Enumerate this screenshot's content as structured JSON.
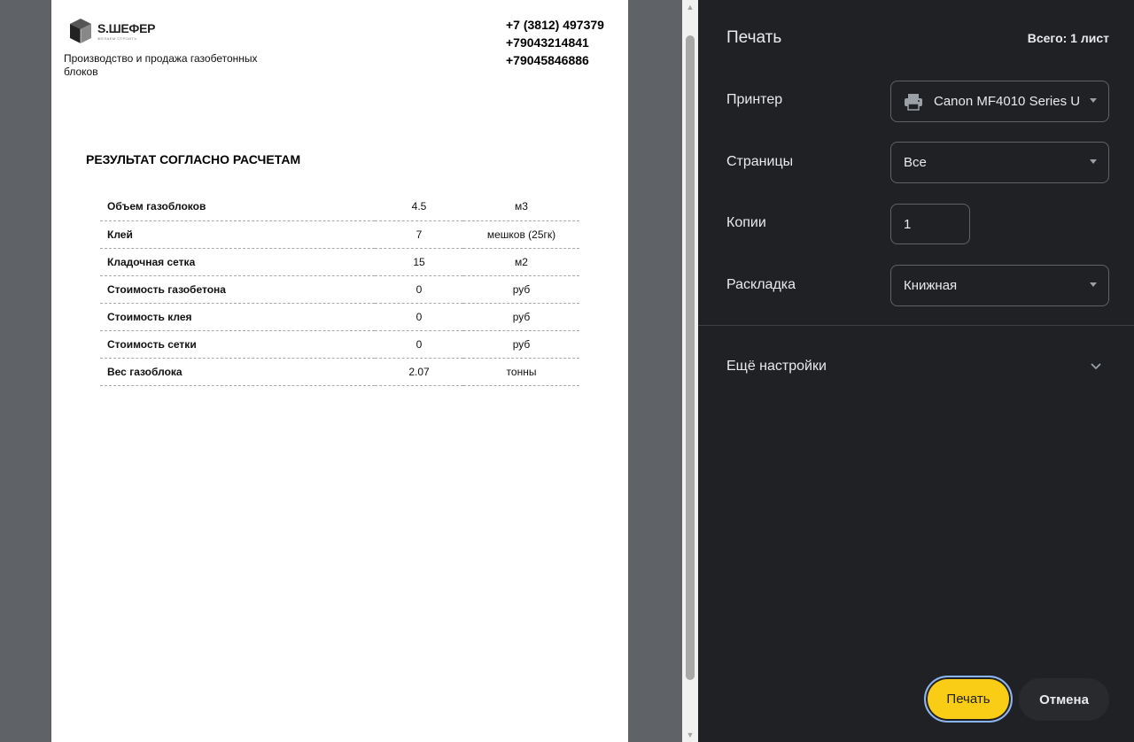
{
  "document": {
    "logo_name": "S.ШЕФЕР",
    "logo_tagline": "ЖЕЛАЕМ СТРОИТЬ",
    "company_description": "Производство и продажа газобетонных блоков",
    "phones": [
      "+7 (3812) 497379",
      "+79043214841",
      "+79045846886"
    ],
    "result_title": "РЕЗУЛЬТАТ СОГЛАСНО РАСЧЕТАМ",
    "rows": [
      {
        "name": "Объем газоблоков",
        "value": "4.5",
        "unit": "м3"
      },
      {
        "name": "Клей",
        "value": "7",
        "unit": "мешков (25гк)"
      },
      {
        "name": "Кладочная сетка",
        "value": "15",
        "unit": "м2"
      },
      {
        "name": "Стоимость газобетона",
        "value": "0",
        "unit": "руб"
      },
      {
        "name": "Стоимость клея",
        "value": "0",
        "unit": "руб"
      },
      {
        "name": "Стоимость сетки",
        "value": "0",
        "unit": "руб"
      },
      {
        "name": "Вес газоблока",
        "value": "2.07",
        "unit": "тонны"
      }
    ]
  },
  "print_panel": {
    "title": "Печать",
    "total_sheets": "Всего: 1 лист",
    "printer_label": "Принтер",
    "printer_value": "Canon MF4010 Series U",
    "pages_label": "Страницы",
    "pages_value": "Все",
    "copies_label": "Копии",
    "copies_value": "1",
    "layout_label": "Раскладка",
    "layout_value": "Книжная",
    "more_settings": "Ещё настройки",
    "print_button": "Печать",
    "cancel_button": "Отмена"
  },
  "colors": {
    "print_button": "#f9cc15",
    "panel_background": "#202124",
    "preview_background": "#5f6368"
  },
  "icons": {
    "printer": "printer-icon",
    "dropdown": "caret-down-icon",
    "expand": "chevron-down-icon",
    "scroll_up": "scroll-up-arrow-icon",
    "scroll_down": "scroll-down-arrow-icon"
  }
}
